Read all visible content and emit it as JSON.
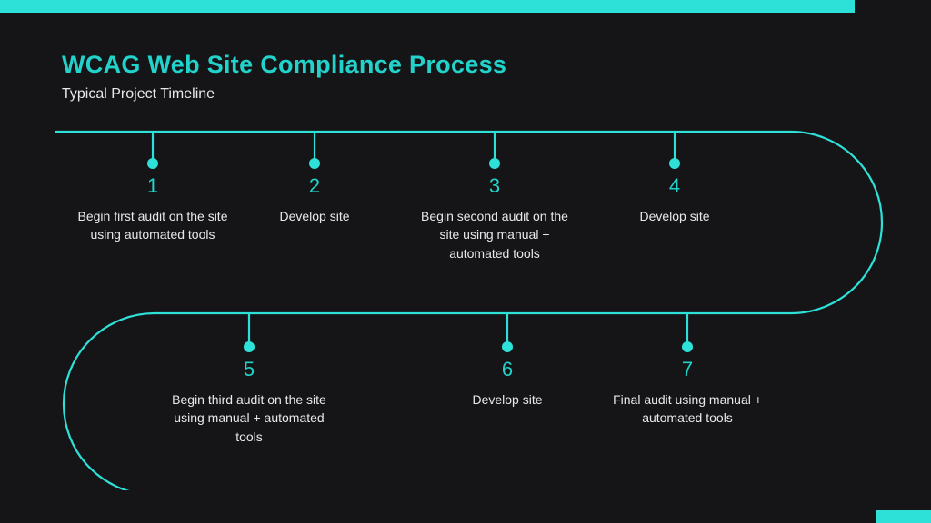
{
  "header": {
    "title": "WCAG Web Site Compliance Process",
    "subtitle": "Typical Project Timeline"
  },
  "colors": {
    "accent": "#2de0d8",
    "background": "#151518",
    "text": "#e8e8e8"
  },
  "steps": [
    {
      "num": "1",
      "desc": "Begin first audit on the site using automated tools"
    },
    {
      "num": "2",
      "desc": "Develop site"
    },
    {
      "num": "3",
      "desc": "Begin second audit on the site using manual + automated tools"
    },
    {
      "num": "4",
      "desc": "Develop site"
    },
    {
      "num": "5",
      "desc": "Begin third audit on the site using manual + automated tools"
    },
    {
      "num": "6",
      "desc": "Develop site"
    },
    {
      "num": "7",
      "desc": "Final audit using manual + automated tools"
    }
  ]
}
